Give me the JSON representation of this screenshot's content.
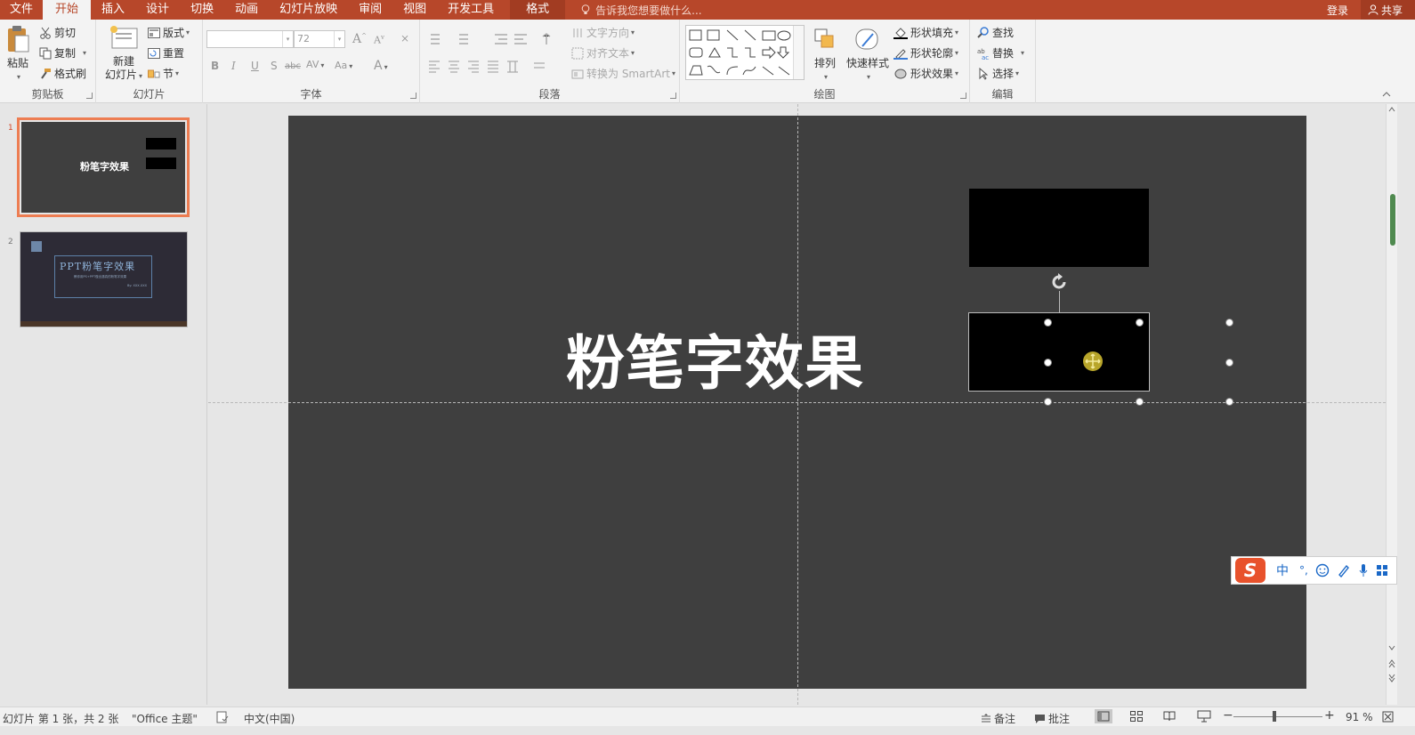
{
  "tabs": [
    {
      "label": "文件"
    },
    {
      "label": "开始"
    },
    {
      "label": "插入"
    },
    {
      "label": "设计"
    },
    {
      "label": "切换"
    },
    {
      "label": "动画"
    },
    {
      "label": "幻灯片放映"
    },
    {
      "label": "审阅"
    },
    {
      "label": "视图"
    },
    {
      "label": "开发工具"
    },
    {
      "label": "格式"
    }
  ],
  "tell_me": "告诉我您想要做什么...",
  "login": "登录",
  "share": "共享",
  "ribbon": {
    "clipboard": {
      "paste": "粘贴",
      "cut": "剪切",
      "copy": "复制",
      "format_painter": "格式刷",
      "label": "剪贴板"
    },
    "slides": {
      "new_slide_line1": "新建",
      "new_slide_line2": "幻灯片",
      "layout": "版式",
      "reset": "重置",
      "section": "节",
      "label": "幻灯片"
    },
    "font": {
      "font_name": "",
      "font_size": "72",
      "label": "字体",
      "bold": "B",
      "italic": "I",
      "underline": "U",
      "shadow": "S",
      "strike": "abc",
      "spacing": "AV",
      "case": "Aa",
      "color": "A"
    },
    "paragraph": {
      "text_direction": "文字方向",
      "align_text": "对齐文本",
      "smartart": "转换为 SmartArt",
      "label": "段落"
    },
    "drawing": {
      "arrange": "排列",
      "quick_styles": "快速样式",
      "shape_fill": "形状填充",
      "shape_outline": "形状轮廓",
      "shape_effects": "形状效果",
      "label": "绘图"
    },
    "editing": {
      "find": "查找",
      "replace": "替换",
      "select": "选择",
      "label": "编辑"
    }
  },
  "thumbnails": [
    {
      "number": "1",
      "title": "粉笔字效果"
    },
    {
      "number": "2",
      "title": "PPT粉笔字效果",
      "subtitle": "教你用PS+PPT做出逼真的粉笔字效果",
      "author": "By: XXX.XXX"
    }
  ],
  "slide": {
    "title": "粉笔字效果"
  },
  "ime": {
    "lang": "中",
    "punct": "°,"
  },
  "status": {
    "slide_count": "幻灯片 第 1 张，共 2 张",
    "theme": "\"Office 主题\"",
    "language": "中文(中国)",
    "notes": "备注",
    "comments": "批注",
    "zoom": "91 %"
  },
  "colors": {
    "accent": "#b7472a",
    "slide_bg": "#3f3f3f",
    "selected_thumb": "#ed7d52"
  }
}
